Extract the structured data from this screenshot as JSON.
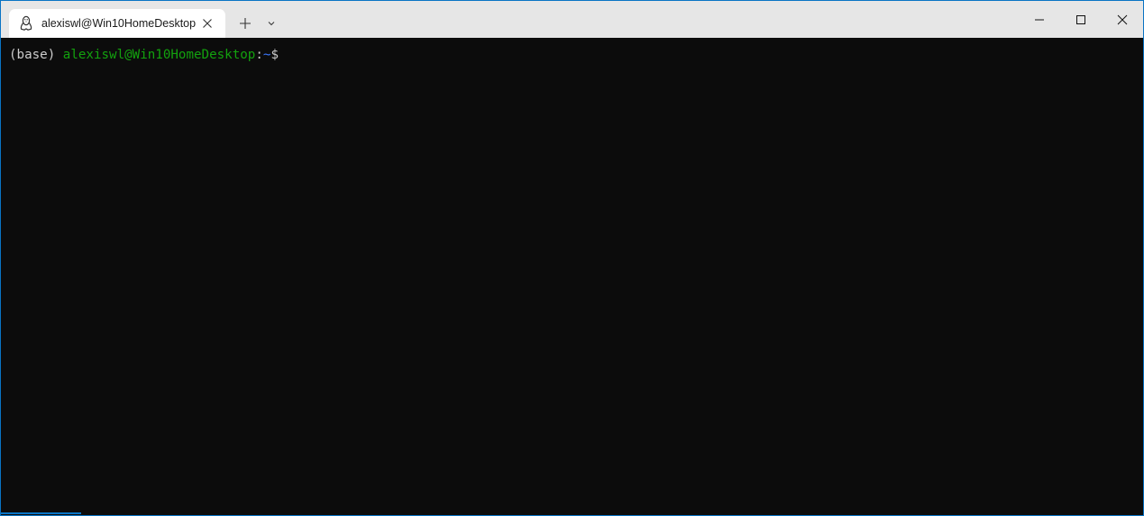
{
  "tab": {
    "title": "alexiswl@Win10HomeDesktop",
    "icon": "linux-penguin-icon"
  },
  "tabbar": {
    "new_tab_icon": "plus-icon",
    "dropdown_icon": "chevron-down-icon"
  },
  "window_controls": {
    "minimize_icon": "minimize-icon",
    "maximize_icon": "maximize-icon",
    "close_icon": "close-icon"
  },
  "terminal": {
    "env": "(base) ",
    "user_host": "alexiswl@Win10HomeDesktop",
    "colon": ":",
    "path": "~",
    "dollar": "$"
  },
  "colors": {
    "background": "#0c0c0c",
    "foreground": "#cccccc",
    "user_host": "#13a10e",
    "path": "#3b78ff",
    "window_border": "#0a74c4"
  }
}
